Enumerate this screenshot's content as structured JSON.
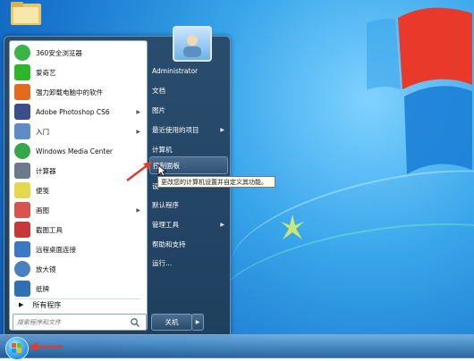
{
  "start_menu": {
    "programs": [
      {
        "label": "360安全浏览器",
        "icon": "360-browser-icon",
        "color": "#3bb24a",
        "arrow": false
      },
      {
        "label": "爱奇艺",
        "icon": "iqiyi-icon",
        "color": "#2fb52a",
        "arrow": false
      },
      {
        "label": "强力卸载电脑中的软件",
        "icon": "uninstall-icon",
        "color": "#e26b1f",
        "arrow": false
      },
      {
        "label": "Adobe Photoshop CS6",
        "icon": "photoshop-icon",
        "color": "#3a4e8c",
        "arrow": true
      },
      {
        "label": "入门",
        "icon": "getting-started-icon",
        "color": "#5f8bc6",
        "arrow": true
      },
      {
        "label": "Windows Media Center",
        "icon": "media-center-icon",
        "color": "#35a84a",
        "arrow": false
      },
      {
        "label": "计算器",
        "icon": "calculator-icon",
        "color": "#6c7b8c",
        "arrow": false
      },
      {
        "label": "便笺",
        "icon": "sticky-notes-icon",
        "color": "#e6d84c",
        "arrow": false
      },
      {
        "label": "画图",
        "icon": "paint-icon",
        "color": "#d9534f",
        "arrow": true
      },
      {
        "label": "截图工具",
        "icon": "snipping-tool-icon",
        "color": "#c7383a",
        "arrow": false
      },
      {
        "label": "远程桌面连接",
        "icon": "remote-desktop-icon",
        "color": "#3b78c4",
        "arrow": false
      },
      {
        "label": "放大镜",
        "icon": "magnifier-icon",
        "color": "#4a7fc0",
        "arrow": false
      },
      {
        "label": "纸牌",
        "icon": "solitaire-icon",
        "color": "#2f6fb3",
        "arrow": false
      }
    ],
    "all_programs": "所有程序",
    "search_placeholder": "搜索程序和文件",
    "right_items": [
      {
        "label": "Administrator",
        "arrow": false
      },
      {
        "label": "文档",
        "arrow": false
      },
      {
        "label": "图片",
        "arrow": false
      },
      {
        "label": "最近使用的项目",
        "arrow": true
      },
      {
        "label": "计算机",
        "arrow": false
      },
      {
        "label": "控制面板",
        "arrow": false
      },
      {
        "label": "设",
        "arrow": false
      },
      {
        "label": "默认程序",
        "arrow": false
      },
      {
        "label": "管理工具",
        "arrow": true
      },
      {
        "label": "帮助和支持",
        "arrow": false
      },
      {
        "label": "运行...",
        "arrow": false
      }
    ],
    "shutdown_label": "关机",
    "tooltip": "更改您的计算机设置并自定义其功能。"
  },
  "colors": {
    "accent": "#e23a2b",
    "menu_bg": "#1f3f5f"
  }
}
